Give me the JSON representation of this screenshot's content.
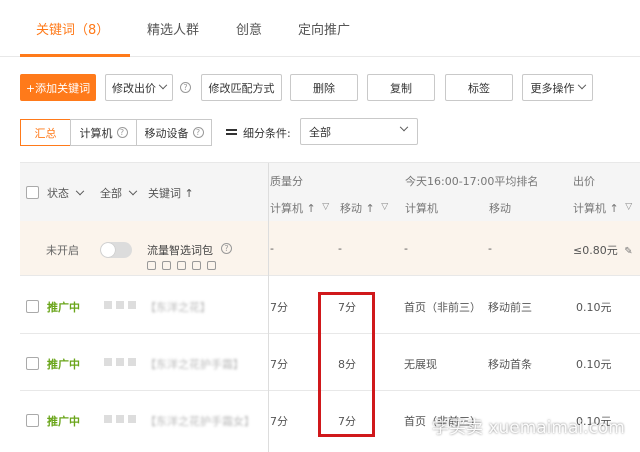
{
  "tabs": [
    {
      "label": "关键词（8）"
    },
    {
      "label": "精选人群"
    },
    {
      "label": "创意"
    },
    {
      "label": "定向推广"
    }
  ],
  "toolbar": {
    "add_keyword": "+添加关键词",
    "modify_bid": "修改出价",
    "modify_match": "修改匹配方式",
    "delete": "删除",
    "copy": "复制",
    "tag": "标签",
    "more_actions": "更多操作"
  },
  "segments": {
    "summary": "汇总",
    "computer": "计算机",
    "mobile": "移动设备"
  },
  "filter": {
    "label": "细分条件:",
    "value": "全部"
  },
  "table_header": {
    "status": "状态",
    "all": "全部",
    "keyword": "关键词 ↑",
    "quality": "质量分",
    "quality_computer": "计算机 ↑",
    "quality_mobile": "移动 ↑",
    "rank_group": "今天16:00-17:00平均排名",
    "rank_computer": "计算机",
    "rank_mobile": "移动",
    "bid_group": "出价",
    "bid_computer": "计算机 ↑"
  },
  "package_row": {
    "status": "未开启",
    "name": "流量智选词包",
    "quality_computer": "-",
    "quality_mobile": "-",
    "rank_computer": "-",
    "rank_mobile": "-",
    "bid": "≤0.80元"
  },
  "rows": [
    {
      "status": "推广中",
      "keyword": "【东洋之花】",
      "quality_computer": "7分",
      "quality_mobile": "7分",
      "rank_computer": "首页（非前三）",
      "rank_mobile": "移动前三",
      "bid": "0.10元"
    },
    {
      "status": "推广中",
      "keyword": "【东洋之花护手霜】",
      "quality_computer": "7分",
      "quality_mobile": "8分",
      "rank_computer": "无展现",
      "rank_mobile": "移动首条",
      "bid": "0.10元"
    },
    {
      "status": "推广中",
      "keyword": "【东洋之花护手霜女】",
      "quality_computer": "7分",
      "quality_mobile": "7分",
      "rank_computer": "首页（非前三）",
      "rank_mobile": "",
      "bid": "0.10元"
    }
  ],
  "watermark": "学买卖 xuemaimai.com",
  "colors": {
    "accent": "#ff7a1a",
    "status_on": "#6aa51a",
    "highlight": "#d0181b"
  }
}
